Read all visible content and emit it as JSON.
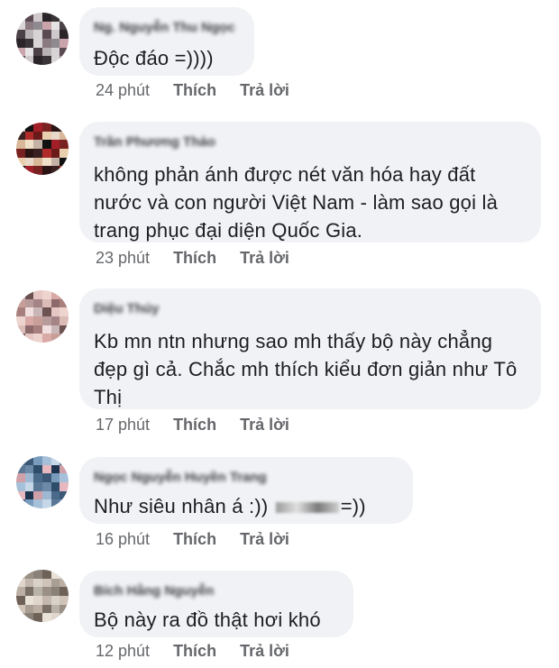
{
  "comments": [
    {
      "author": "Ng. Nguyễn Thu Ngọc",
      "text": "Độc đáo =))))",
      "time": "24 phút",
      "like_label": "Thích",
      "reply_label": "Trả lời",
      "avatar_colors": [
        "#d7d3d4",
        "#8f8a90",
        "#cfc9cc",
        "#e6e3e4",
        "#3a3439",
        "#b9b3b6",
        "#8b7b80",
        "#5a4a52",
        "#c9a4ab",
        "#2b2529",
        "#4b4146",
        "#d9d4d6"
      ]
    },
    {
      "author": "Trần Phương Thảo",
      "text": "không phản ánh được nét văn hóa hay đất nước và con người Việt Nam - làm sao gọi là trang phục đại diện Quốc Gia.",
      "time": "23 phút",
      "like_label": "Thích",
      "reply_label": "Trả lời",
      "avatar_colors": [
        "#c4b2a6",
        "#6b1a1a",
        "#a31f28",
        "#e8d8c8",
        "#2a1414",
        "#f0e0c8",
        "#b02a2a",
        "#111111",
        "#e9cfae",
        "#7a2222",
        "#d8b898",
        "#3a2020"
      ]
    },
    {
      "author": "Diệu Thúy",
      "text": "Kb mn ntn nhưng sao mh thấy bộ này chẳng đẹp gì cả. Chắc mh thích kiểu đơn giản như Tô Thị",
      "time": "17 phút",
      "like_label": "Thích",
      "reply_label": "Trả lời",
      "avatar_colors": [
        "#c9b6b6",
        "#a48486",
        "#e6c7c4",
        "#8c6a6c",
        "#d9a9a6",
        "#f1dede",
        "#b89c9c",
        "#6d5252",
        "#dcbcb6",
        "#eed4cf",
        "#a7807d",
        "#c79e98"
      ]
    },
    {
      "author": "Ngọc Nguyễn Huyền Trang",
      "text": "Như siêu nhân á :)) ",
      "text_tail": "=))",
      "time": "16 phút",
      "like_label": "Thích",
      "reply_label": "Trả lời",
      "avatar_colors": [
        "#4a6a8a",
        "#2e4d6b",
        "#7a9cbc",
        "#1d3550",
        "#c6d8e8",
        "#9fb8d2",
        "#6c8aa8",
        "#3b5977",
        "#e8b8c0",
        "#a5c0d8",
        "#d0a0a8",
        "#5a7896"
      ]
    },
    {
      "author": "Bích Hằng Nguyễn",
      "text": "Bộ này ra đồ thật hơi khó",
      "time": "12 phút",
      "like_label": "Thích",
      "reply_label": "Trả lời",
      "avatar_colors": [
        "#b8b2a8",
        "#d8d2c8",
        "#8a8278",
        "#a89e94",
        "#e8e2d8",
        "#7a6f66",
        "#c4b8ae",
        "#9a9086",
        "#d0c4b8",
        "#6e6258",
        "#bcb0a4",
        "#e0d6cc"
      ]
    }
  ]
}
